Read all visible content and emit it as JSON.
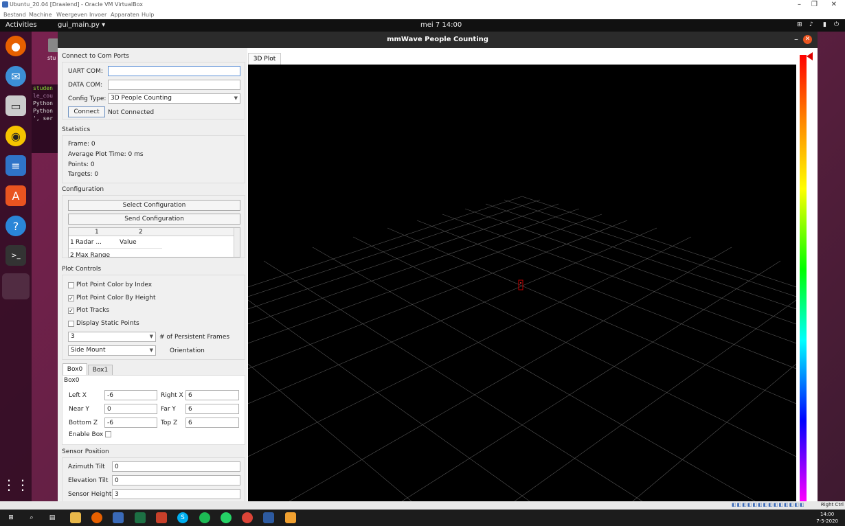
{
  "vbox": {
    "title": "Ubuntu_20.04 [Draaiend] - Oracle VM VirtualBox",
    "menu": [
      "Bestand",
      "Machine",
      "Weergeven",
      "Invoer",
      "Apparaten",
      "Hulp"
    ],
    "host_key": "Right Ctrl"
  },
  "topbar": {
    "activities": "Activities",
    "app_menu": "gui_main.py ▾",
    "clock": "mei 7  14:00"
  },
  "terminal_lines": [
    "studen",
    "le_cou",
    "Python",
    "Python",
    "', ser"
  ],
  "desktop_label": "stu",
  "app": {
    "title": "mmWave People Counting",
    "tab": "3D Plot"
  },
  "com": {
    "title": "Connect to Com Ports",
    "uart_label": "UART COM:",
    "uart_value": "",
    "data_label": "DATA COM:",
    "data_value": "",
    "config_label": "Config Type:",
    "config_value": "3D People Counting",
    "connect_btn": "Connect",
    "status": "Not Connected"
  },
  "stats": {
    "title": "Statistics",
    "frame": "Frame: 0",
    "avg": "Average Plot Time: 0 ms",
    "points": "Points: 0",
    "targets": "Targets: 0"
  },
  "config": {
    "title": "Configuration",
    "select_btn": "Select Configuration",
    "send_btn": "Send Configuration",
    "col1": "1",
    "col2": "2",
    "row1_num": "1",
    "row1_c1": "Radar ...",
    "row1_c2": "Value",
    "row2_num": "2",
    "row2_c1": "Max Range"
  },
  "plot_controls": {
    "title": "Plot Controls",
    "opt1": "Plot Point Color by Index",
    "opt2": "Plot Point Color By Height",
    "opt3": "Plot Tracks",
    "opt4": "Display Static Points",
    "frames_value": "3",
    "frames_label": "# of Persistent Frames",
    "orient_value": "Side Mount",
    "orient_label": "Orientation"
  },
  "box": {
    "tab0": "Box0",
    "tab1": "Box1",
    "group": "Box0",
    "left_x_label": "Left X",
    "left_x": "-6",
    "right_x_label": "Right X",
    "right_x": "6",
    "near_y_label": "Near Y",
    "near_y": "0",
    "far_y_label": "Far Y",
    "far_y": "6",
    "bottom_z_label": "Bottom Z",
    "bottom_z": "-6",
    "top_z_label": "Top Z",
    "top_z": "6",
    "enable_label": "Enable Box"
  },
  "sensor": {
    "title": "Sensor Position",
    "az_label": "Azimuth Tilt",
    "az": "0",
    "el_label": "Elevation Tilt",
    "el": "0",
    "h_label": "Sensor Height",
    "h": "3"
  },
  "taskbar": {
    "time": "14:00",
    "date": "7-5-2020"
  }
}
